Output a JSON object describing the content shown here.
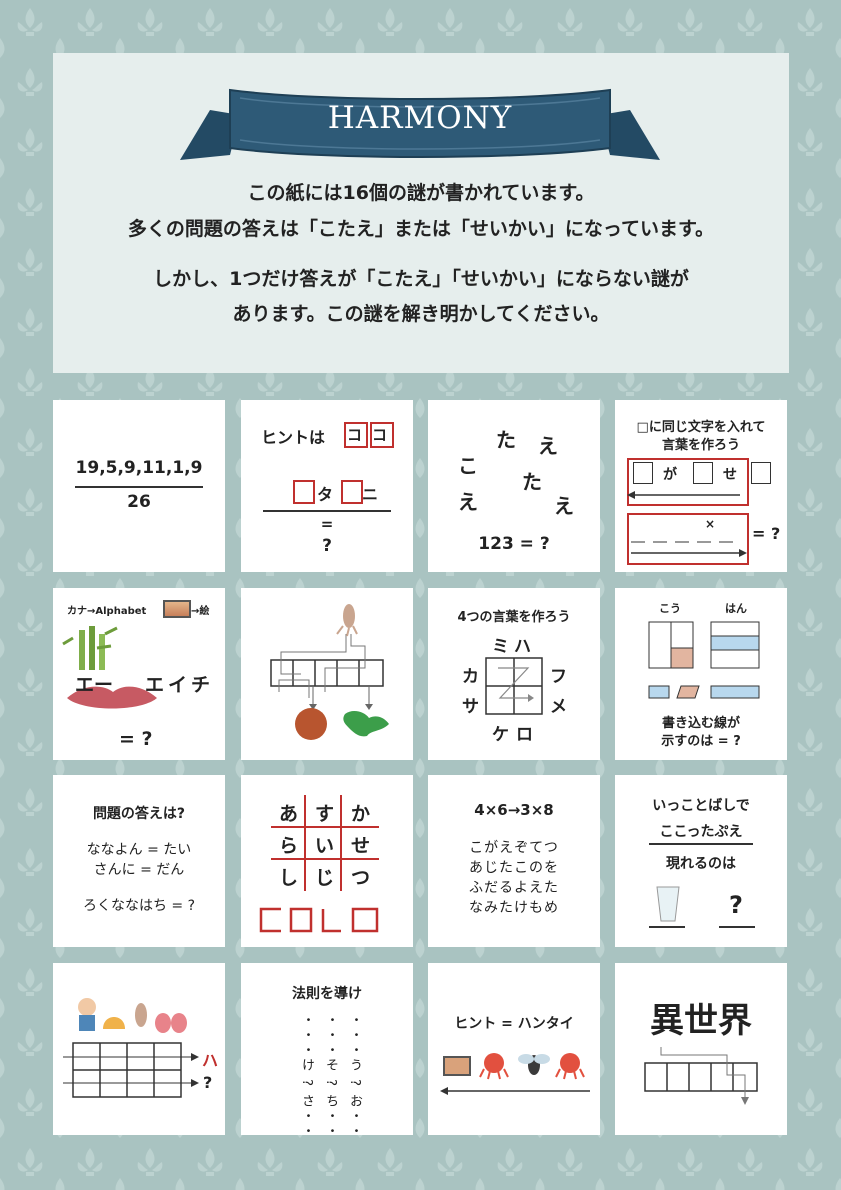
{
  "banner": {
    "title": "HARMONY",
    "color": "#2e5a77"
  },
  "intro": {
    "line1": "この紙には16個の謎が書かれています。",
    "line2": "多くの問題の答えは「こたえ」または「せいかい」になっています。",
    "line3": "しかし、1つだけ答えが「こたえ」「せいかい」にならない謎が",
    "line4": "あります。この謎を解き明かしてください。"
  },
  "colors": {
    "accent_red": "#c0302e",
    "background": "#a9c3c1",
    "panel": "#e6eeed"
  },
  "p1": {
    "numerator": "19,5,9,11,1,9",
    "denominator": "26"
  },
  "p2": {
    "hint": "ヒントは",
    "hint_boxes": "ココ",
    "ta": "タ",
    "ni": "ニ",
    "eq": "=",
    "q": "?"
  },
  "p3": {
    "ko": "こ",
    "ta1": "た",
    "e1": "え",
    "e2": "え",
    "ta2": "た",
    "e3": "え",
    "eq": "123 = ?"
  },
  "p4": {
    "title1": "□に同じ文字を入れて",
    "title2": "言葉を作ろう",
    "ga": "が",
    "se": "せ",
    "x": "×",
    "eq": "= ?"
  },
  "p5": {
    "label": "カナ→Alphabet",
    "label2": "→絵",
    "ee": "エー",
    "eichi": "エイチ",
    "eq": "= ?"
  },
  "p6": {
    "icons": [
      "squid-icon",
      "mars-icon",
      "world-map-icon"
    ]
  },
  "p7": {
    "title": "4つの言葉を作ろう",
    "mi": "ミ",
    "ha": "ハ",
    "ka": "カ",
    "fu": "フ",
    "sa": "サ",
    "me": "メ",
    "ke": "ケ",
    "ro": "ロ"
  },
  "p8": {
    "kou": "こう",
    "han": "はん",
    "text1": "書き込む線が",
    "text2": "示すのは = ?",
    "fill": "#e2b5a0",
    "blue": "#b8d8ee"
  },
  "p9": {
    "q": "問題の答えは?",
    "l1": "ななよん = たい",
    "l2": "さんに = だん",
    "l3": "ろくななはち = ?"
  },
  "p10": {
    "grid": [
      "あ",
      "す",
      "か",
      "ら",
      "い",
      "せ",
      "し",
      "じ",
      "つ"
    ]
  },
  "p11": {
    "rule": "4×6→3×8",
    "rows": [
      "こがえぞてつ",
      "あじたこのを",
      "ふだるよえた",
      "なみたけもめ"
    ]
  },
  "p12": {
    "l1": "いっことばしで",
    "l2": "ここったぷえ",
    "l3": "現れるのは",
    "q": "?"
  },
  "p13": {
    "ha": "ハ",
    "q": "?",
    "icons": [
      "boy-icon",
      "shell-icon",
      "squid-icon",
      "lungs-icon"
    ]
  },
  "p14": {
    "title": "法則を導け",
    "col1": "け ? さ",
    "col2": "そ ? ち",
    "col3": "う ? お"
  },
  "p15": {
    "hint": "ヒント = ハンタイ",
    "icons": [
      "painting-icon",
      "octopus-icon",
      "fly-icon",
      "octopus-icon"
    ]
  },
  "p16": {
    "title": "異世界"
  }
}
